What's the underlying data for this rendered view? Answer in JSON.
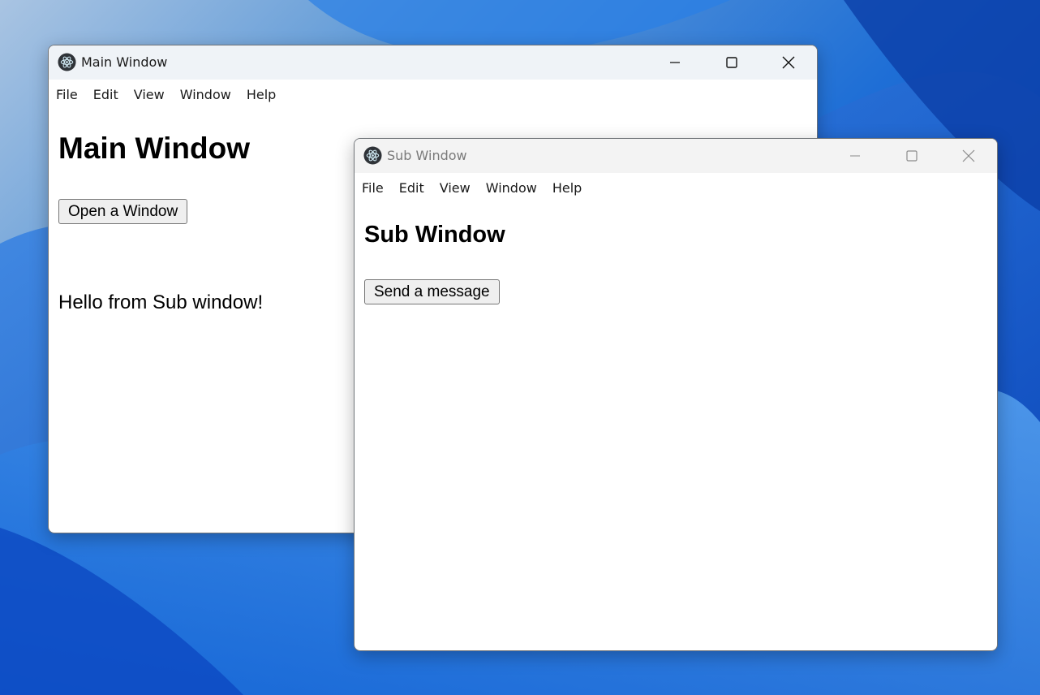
{
  "main_window": {
    "title": "Main Window",
    "menu": [
      "File",
      "Edit",
      "View",
      "Window",
      "Help"
    ],
    "heading": "Main Window",
    "button_label": "Open a Window",
    "message": "Hello from Sub window!"
  },
  "sub_window": {
    "title": "Sub Window",
    "menu": [
      "File",
      "Edit",
      "View",
      "Window",
      "Help"
    ],
    "heading": "Sub Window",
    "button_label": "Send a message"
  },
  "icons": {
    "app": "electron-app-icon",
    "minimize": "minimize-icon",
    "maximize": "maximize-icon",
    "close": "close-icon"
  },
  "colors": {
    "desktop_accent": "#1f6fd6",
    "active_titlebar": "#eff3f7",
    "inactive_titlebar": "#f3f3f3",
    "button_bg": "#efefef"
  }
}
